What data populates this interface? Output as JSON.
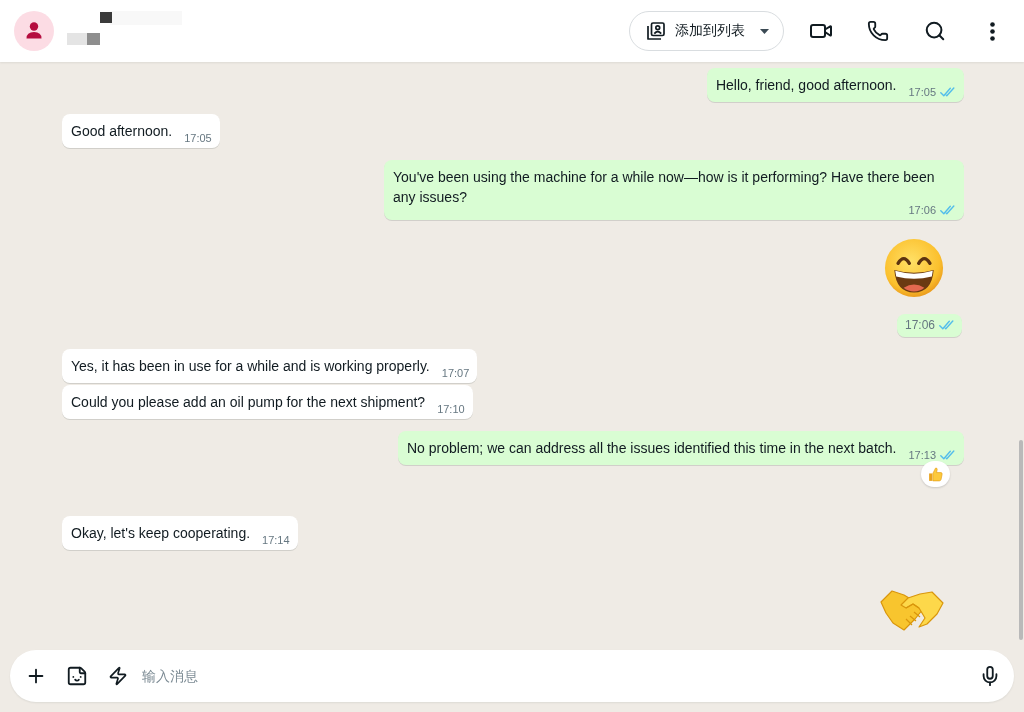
{
  "header": {
    "add_to_list": "添加到列表"
  },
  "messages": [
    {
      "kind": "text",
      "outgoing": true,
      "text": "Hello, friend, good afternoon.",
      "time": "17:05",
      "read": true,
      "reacted": false
    },
    {
      "kind": "text",
      "outgoing": false,
      "text": "Good afternoon.",
      "time": "17:05",
      "reacted": false
    },
    {
      "kind": "text",
      "outgoing": true,
      "text": "You've been using the machine for a while now—how is it performing? Have there been any issues?",
      "time": "17:06",
      "read": true,
      "reacted": false
    },
    {
      "kind": "grin",
      "outgoing": true,
      "time": "17:06",
      "read": true,
      "reacted": false
    },
    {
      "kind": "text",
      "outgoing": false,
      "text": "Yes, it has been in use for a while and is working properly.",
      "time": "17:07",
      "reacted": false
    },
    {
      "kind": "text",
      "outgoing": false,
      "text": "Could you please add an oil pump for the next shipment?",
      "time": "17:10",
      "reacted": false
    },
    {
      "kind": "text",
      "outgoing": true,
      "text": "No problem; we can address all the issues identified this time in the next batch.",
      "time": "17:13",
      "read": true,
      "reacted": true
    },
    {
      "kind": "text",
      "outgoing": false,
      "text": "Okay, let's keep cooperating.",
      "time": "17:14",
      "reacted": false
    },
    {
      "kind": "handshake",
      "outgoing": true,
      "reacted": false
    }
  ],
  "composer": {
    "placeholder": "输入消息"
  }
}
